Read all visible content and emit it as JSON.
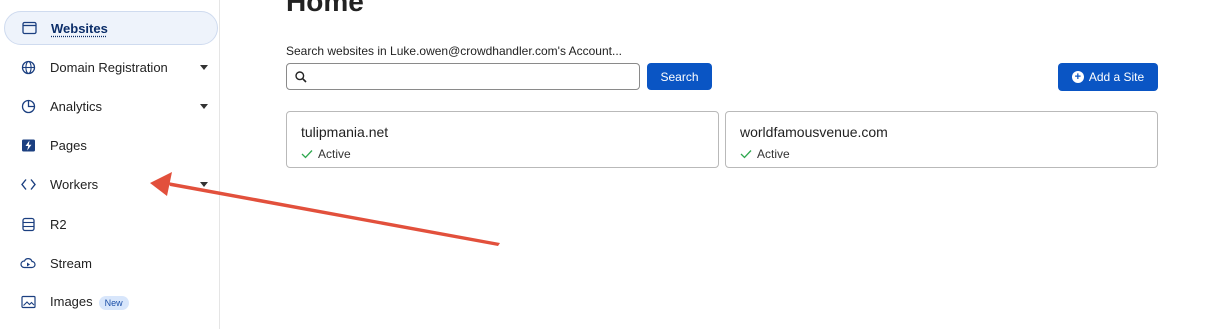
{
  "sidebar": {
    "items": [
      {
        "label": "Websites",
        "icon": "browser-window-icon",
        "active": true,
        "caret": false
      },
      {
        "label": "Domain Registration",
        "icon": "globe-icon",
        "caret": true
      },
      {
        "label": "Analytics",
        "icon": "pie-chart-icon",
        "caret": true
      },
      {
        "label": "Pages",
        "icon": "lightning-bolt-icon",
        "caret": false
      },
      {
        "label": "Workers",
        "icon": "diamond-code-icon",
        "caret": true
      },
      {
        "label": "R2",
        "icon": "database-icon",
        "caret": false
      },
      {
        "label": "Stream",
        "icon": "cloud-play-icon",
        "caret": false
      },
      {
        "label": "Images",
        "icon": "image-icon",
        "caret": false,
        "badge": "New"
      }
    ]
  },
  "main": {
    "title": "Home",
    "search": {
      "label": "Search websites in Luke.owen@crowdhandler.com's Account...",
      "value": "",
      "placeholder": "",
      "button_label": "Search"
    },
    "add_site_label": "Add a Site",
    "sites": [
      {
        "domain": "tulipmania.net",
        "status": "Active"
      },
      {
        "domain": "worldfamousvenue.com",
        "status": "Active"
      }
    ]
  },
  "colors": {
    "primary": "#0a55c4",
    "active_bg": "#eef3fb",
    "status_check": "#2fa84f",
    "annotation_arrow": "#e2503c"
  }
}
